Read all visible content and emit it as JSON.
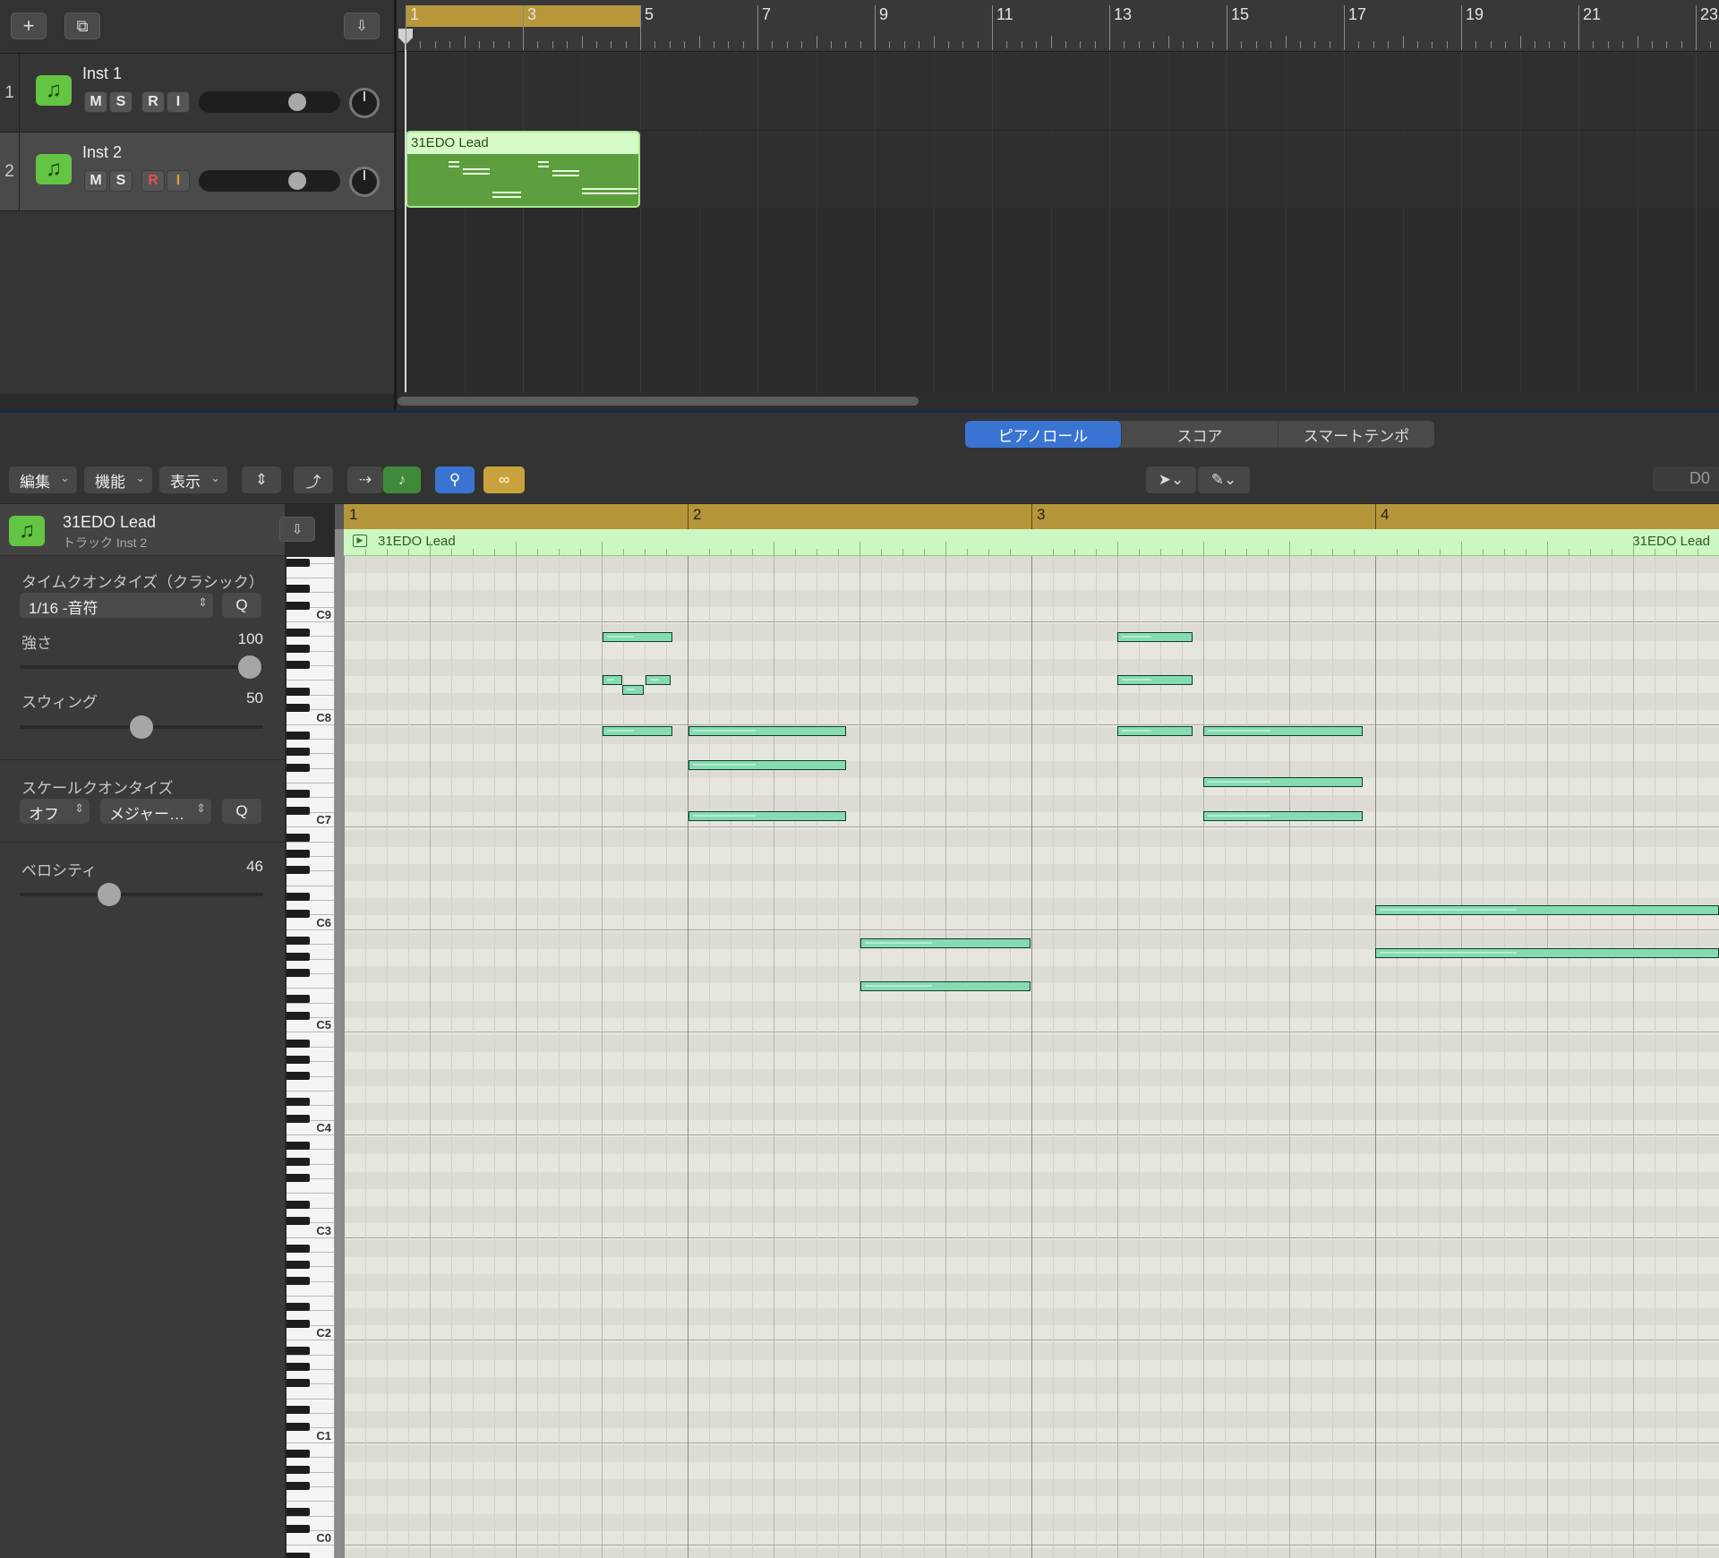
{
  "arrange": {
    "ruler_numbers": [
      "1",
      "3",
      "5",
      "7",
      "9",
      "11",
      "13",
      "15",
      "17",
      "19",
      "21",
      "23"
    ],
    "tracks": [
      {
        "number": "1",
        "name": "Inst 1",
        "m": "M",
        "s": "S",
        "r": "R",
        "i": "I",
        "volume": 0.58
      },
      {
        "number": "2",
        "name": "Inst 2",
        "m": "M",
        "s": "S",
        "r": "R",
        "i": "I",
        "volume": 0.58
      }
    ],
    "region_name": "31EDO Lead"
  },
  "editor": {
    "tabs": [
      "ピアノロール",
      "スコア",
      "スマートテンポ"
    ],
    "active_tab": "ピアノロール",
    "menus": [
      "編集",
      "機能",
      "表示"
    ],
    "key_display": "D0",
    "region_name": "31EDO Lead",
    "region_name_right": "31EDO Lead",
    "bar_numbers": [
      "1",
      "2",
      "3",
      "4"
    ],
    "octave_labels": [
      "C9",
      "C8",
      "C7",
      "C6",
      "C5",
      "C4",
      "C3",
      "C2",
      "C1",
      "C0"
    ]
  },
  "inspector": {
    "region_title": "31EDO Lead",
    "track_subtitle": "トラック Inst 2",
    "time_quantize_label": "タイムクオンタイズ（クラシック）",
    "time_quantize_value": "1/16 -音符",
    "q_label": "Q",
    "strength_label": "強さ",
    "strength_value": "100",
    "swing_label": "スウィング",
    "swing_value": "50",
    "scale_quantize_label": "スケールクオンタイズ",
    "scale_off": "オフ",
    "scale_type": "メジャー…",
    "velocity_label": "ベロシティ",
    "velocity_value": "46"
  },
  "colors": {
    "region_green": "#5d9f3e",
    "note_fill": "#86dbb1",
    "ruler_gold": "#b6963a",
    "tab_active": "#3a74d3"
  },
  "icons": [
    "plus-icon",
    "duplicate-icon",
    "download-icon",
    "pointer-tool-icon",
    "pencil-tool-icon",
    "link-icon",
    "midi-in-icon",
    "note-icon"
  ]
}
